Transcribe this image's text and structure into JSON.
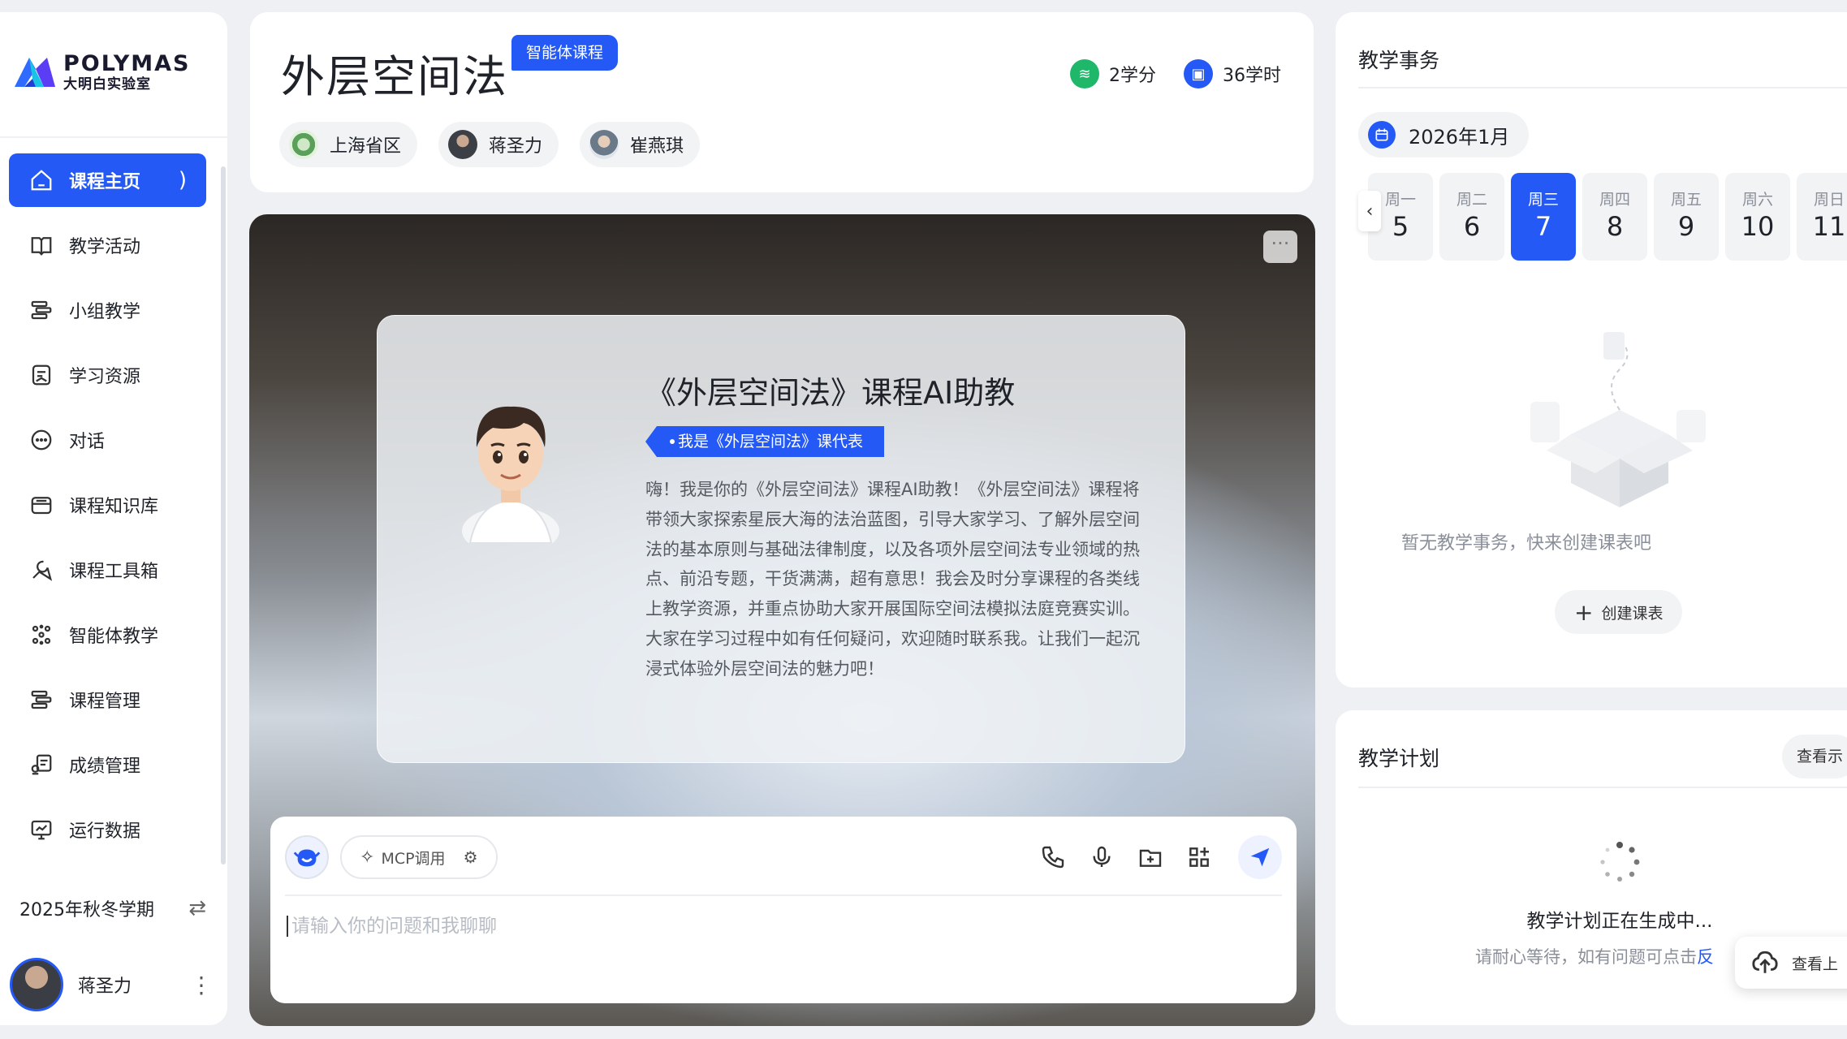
{
  "brand": {
    "name": "POLYMAS",
    "subtitle": "大明白实验室"
  },
  "sidebar": {
    "items": [
      {
        "label": "课程主页",
        "icon": "home-icon",
        "active": true
      },
      {
        "label": "教学活动",
        "icon": "book-icon"
      },
      {
        "label": "小组教学",
        "icon": "group-icon"
      },
      {
        "label": "学习资源",
        "icon": "resource-icon"
      },
      {
        "label": "对话",
        "icon": "chat-icon"
      },
      {
        "label": "课程知识库",
        "icon": "database-icon"
      },
      {
        "label": "课程工具箱",
        "icon": "tools-icon"
      },
      {
        "label": "智能体教学",
        "icon": "agent-icon"
      },
      {
        "label": "课程管理",
        "icon": "manage-icon"
      },
      {
        "label": "成绩管理",
        "icon": "grade-icon"
      },
      {
        "label": "运行数据",
        "icon": "data-icon"
      }
    ],
    "active_arrow": ")",
    "semester": "2025年秋冬学期",
    "user": "蒋圣力"
  },
  "header": {
    "title": "外层空间法",
    "badge": "智能体课程",
    "credits": "2学分",
    "hours": "36学时",
    "people": [
      "上海省区",
      "蒋圣力",
      "崔燕琪"
    ]
  },
  "hero": {
    "ai_title": "《外层空间法》课程AI助教",
    "ai_tag": "我是《外层空间法》课代表",
    "ai_desc": "嗨！我是你的《外层空间法》课程AI助教！《外层空间法》课程将带领大家探索星辰大海的法治蓝图，引导大家学习、了解外层空间法的基本原则与基础法律制度，以及各项外层空间法专业领域的热点、前沿专题，干货满满，超有意思！我会及时分享课程的各类线上教学资源，并重点协助大家开展国际空间法模拟法庭竞赛实训。大家在学习过程中如有任何疑问，欢迎随时联系我。让我们一起沉浸式体验外层空间法的魅力吧！",
    "more": "···"
  },
  "chat": {
    "mcp_label": "MCP调用",
    "placeholder": "请输入你的问题和我聊聊"
  },
  "affairs": {
    "title": "教学事务",
    "month": "2026年1月",
    "prev": "‹",
    "days": [
      {
        "name": "周一",
        "date": "5"
      },
      {
        "name": "周二",
        "date": "6"
      },
      {
        "name": "周三",
        "date": "7",
        "active": true
      },
      {
        "name": "周四",
        "date": "8"
      },
      {
        "name": "周五",
        "date": "9"
      },
      {
        "name": "周六",
        "date": "10"
      },
      {
        "name": "周日",
        "date": "11"
      }
    ],
    "empty_text": "暂无教学事务，快来创建课表吧",
    "create_label": "创建课表"
  },
  "plan": {
    "title": "教学计划",
    "view_label": "查看示",
    "generating": "教学计划正在生成中...",
    "wait_text": "请耐心等待，如有问题可点击",
    "wait_link": "反"
  },
  "upload": {
    "label": "查看上"
  },
  "colors": {
    "accent": "#2459f5",
    "credit_green": "#1fb86b"
  }
}
